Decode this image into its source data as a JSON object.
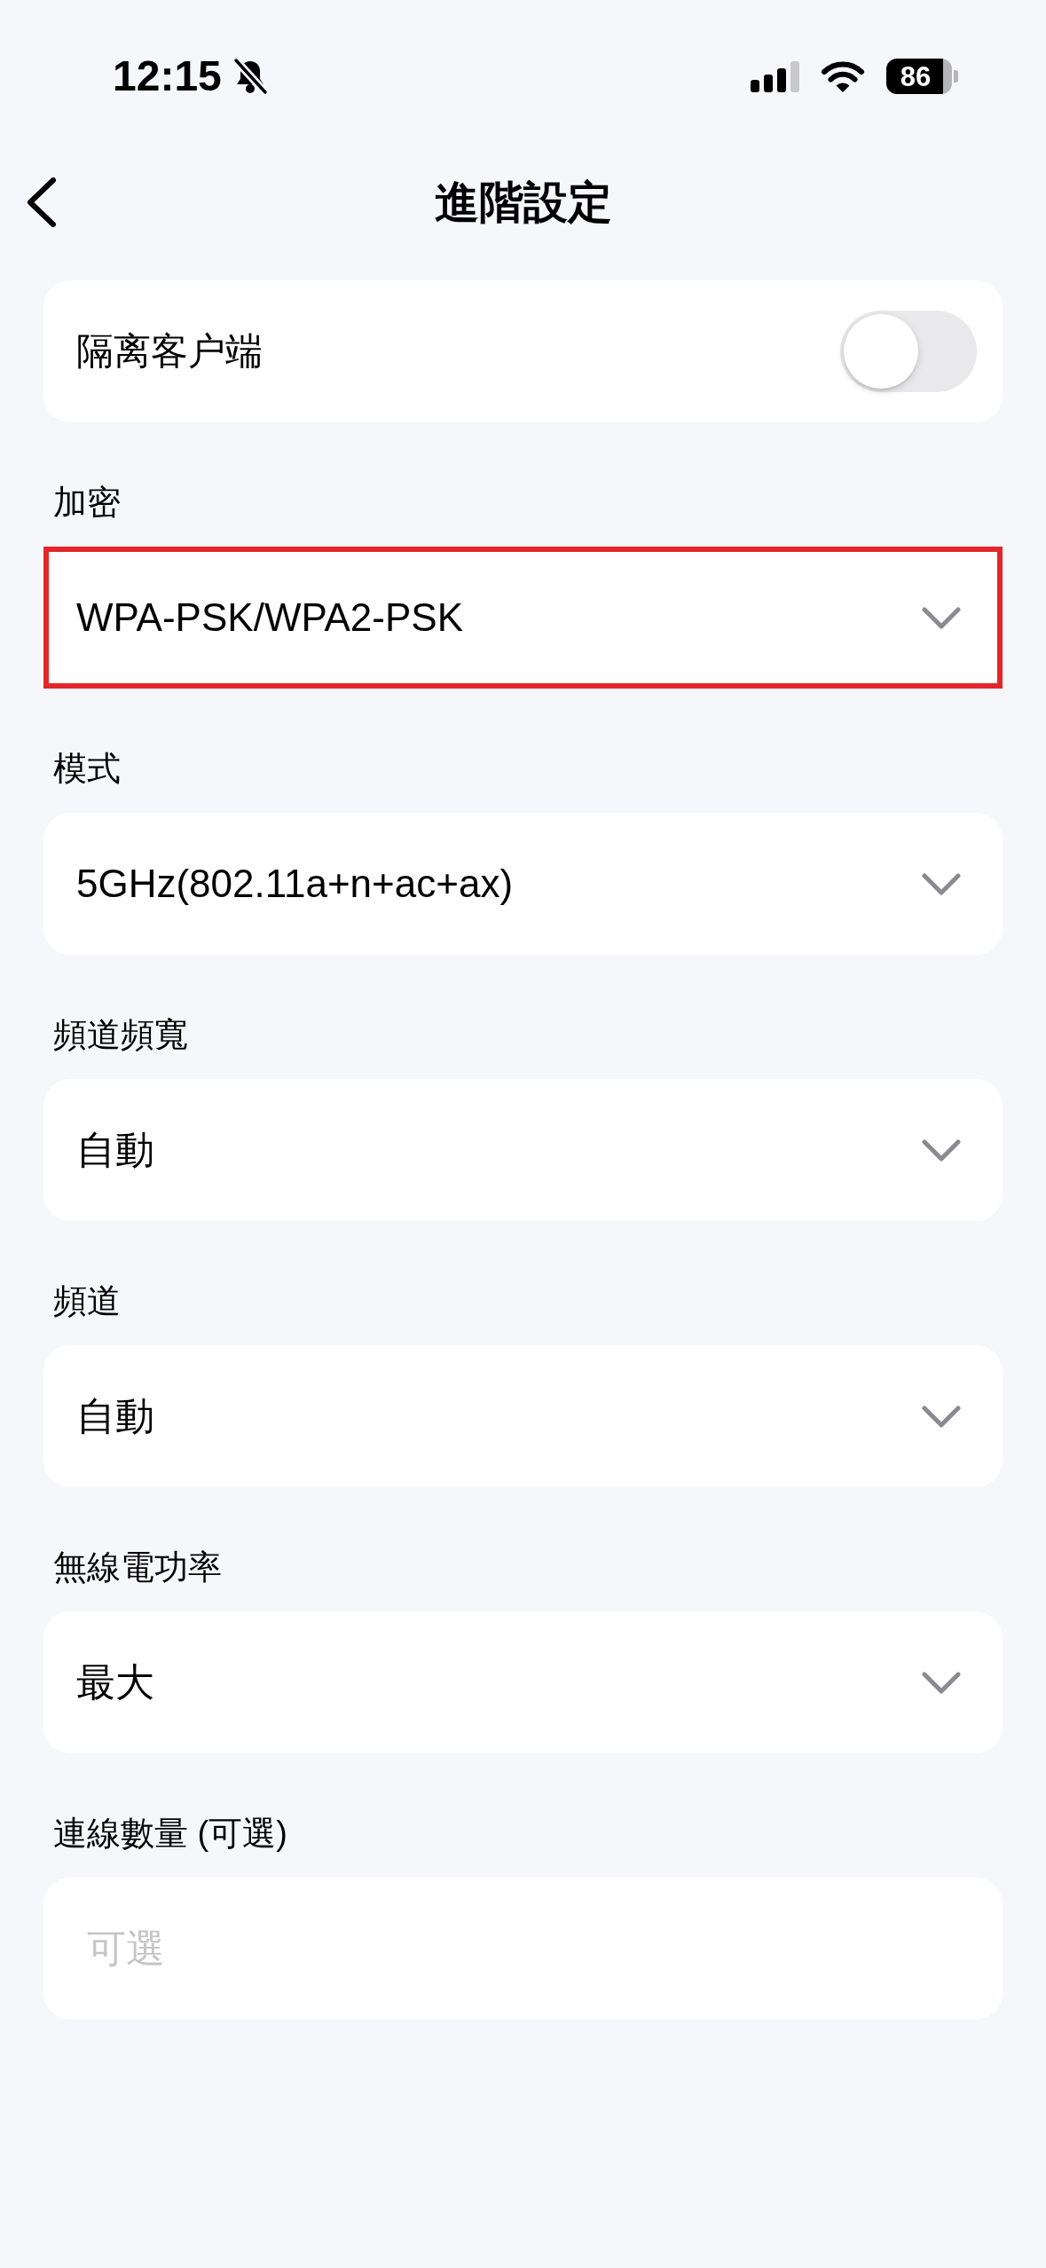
{
  "status_bar": {
    "time": "12:15",
    "battery": "86"
  },
  "header": {
    "title": "進階設定"
  },
  "toggle": {
    "label": "隔离客户端",
    "on": false
  },
  "fields": [
    {
      "label": "加密",
      "kind": "dropdown",
      "value": "WPA-PSK/WPA2-PSK",
      "highlighted": true
    },
    {
      "label": "模式",
      "kind": "dropdown",
      "value": "5GHz(802.11a+n+ac+ax)",
      "highlighted": false
    },
    {
      "label": "頻道頻寬",
      "kind": "dropdown",
      "value": "自動",
      "highlighted": false
    },
    {
      "label": "頻道",
      "kind": "dropdown",
      "value": "自動",
      "highlighted": false
    },
    {
      "label": "無線電功率",
      "kind": "dropdown",
      "value": "最大",
      "highlighted": false
    },
    {
      "label": "連線數量 (可選)",
      "kind": "input",
      "placeholder": "可選",
      "highlighted": false
    }
  ]
}
